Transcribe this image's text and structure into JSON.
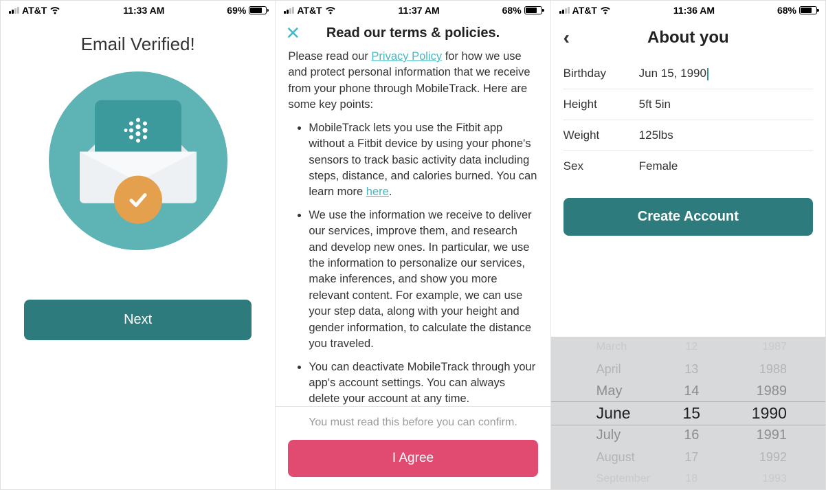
{
  "screen1": {
    "status": {
      "carrier": "AT&T",
      "time": "11:33 AM",
      "battery": "69%",
      "battery_fill": 69
    },
    "title": "Email Verified!",
    "next": "Next"
  },
  "screen2": {
    "status": {
      "carrier": "AT&T",
      "time": "11:37 AM",
      "battery": "68%",
      "battery_fill": 68
    },
    "title": "Read our terms & policies.",
    "intro_pre": "Please read our ",
    "privacy_link": "Privacy Policy",
    "intro_post": " for how we use and protect personal information that we receive from your phone through MobileTrack. Here are some key points:",
    "bullet1_pre": "MobileTrack lets you use the Fitbit app without a Fitbit device by using your phone's sensors to track basic activity data including steps, distance, and calories burned. You can learn more ",
    "bullet1_link": "here",
    "bullet1_post": ".",
    "bullet2": "We use the information we receive to deliver our services, improve them, and research and develop new ones. In particular, we use the information to personalize our services, make inferences, and show you more relevant content. For example, we can use your step data, along with your height and gender information, to calculate the distance you traveled.",
    "bullet3": "You can deactivate MobileTrack through your app's account settings. You can always delete your account at any time.",
    "note": "You must read this before you can confirm.",
    "agree": "I Agree"
  },
  "screen3": {
    "status": {
      "carrier": "AT&T",
      "time": "11:36 AM",
      "battery": "68%",
      "battery_fill": 68
    },
    "title": "About you",
    "fields": {
      "birthday": {
        "label": "Birthday",
        "value": "Jun 15, 1990"
      },
      "height": {
        "label": "Height",
        "value": "5ft 5in"
      },
      "weight": {
        "label": "Weight",
        "value": "125lbs"
      },
      "sex": {
        "label": "Sex",
        "value": "Female"
      }
    },
    "create": "Create Account",
    "picker": {
      "months": [
        "March",
        "April",
        "May",
        "June",
        "July",
        "August",
        "September"
      ],
      "days": [
        "12",
        "13",
        "14",
        "15",
        "16",
        "17",
        "18"
      ],
      "years": [
        "1987",
        "1988",
        "1989",
        "1990",
        "1991",
        "1992",
        "1993"
      ]
    }
  }
}
